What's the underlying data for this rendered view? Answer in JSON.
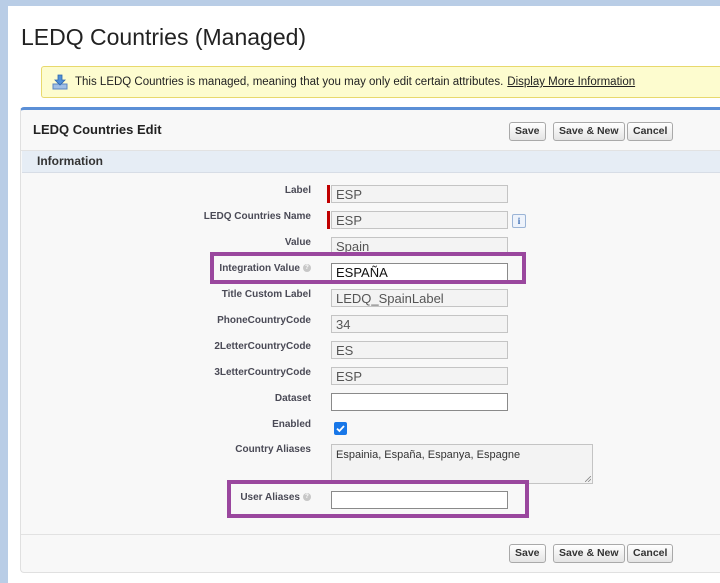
{
  "page_title": "LEDQ Countries (Managed)",
  "info": {
    "message": "This LEDQ Countries is managed, meaning that you may only edit certain attributes.",
    "link": "Display More Information"
  },
  "panel": {
    "title": "LEDQ Countries Edit",
    "buttons": {
      "save": "Save",
      "save_new": "Save & New",
      "cancel": "Cancel"
    },
    "section": "Information"
  },
  "fields": {
    "label": {
      "label": "Label",
      "value": "ESP"
    },
    "name": {
      "label": "LEDQ Countries Name",
      "value": "ESP",
      "info_icon": "i"
    },
    "value": {
      "label": "Value",
      "value": "Spain"
    },
    "integration_value": {
      "label": "Integration Value",
      "value": "ESPAÑA"
    },
    "title_custom_label": {
      "label": "Title Custom Label",
      "value": "LEDQ_SpainLabel"
    },
    "phone_country_code": {
      "label": "PhoneCountryCode",
      "value": "34"
    },
    "two_letter": {
      "label": "2LetterCountryCode",
      "value": "ES"
    },
    "three_letter": {
      "label": "3LetterCountryCode",
      "value": "ESP"
    },
    "dataset": {
      "label": "Dataset",
      "value": ""
    },
    "enabled": {
      "label": "Enabled",
      "checked": true
    },
    "country_aliases": {
      "label": "Country Aliases",
      "value": "Espainia, España, Espanya, Espagne"
    },
    "user_aliases": {
      "label": "User Aliases",
      "value": ""
    }
  },
  "colors": {
    "highlight": "#9a479e",
    "required": "#c00000",
    "checkbox": "#1877e8",
    "header_accent": "#5b8fd6"
  },
  "icons": [
    "download-info-icon",
    "help-icon",
    "info-icon",
    "checkmark-icon"
  ]
}
